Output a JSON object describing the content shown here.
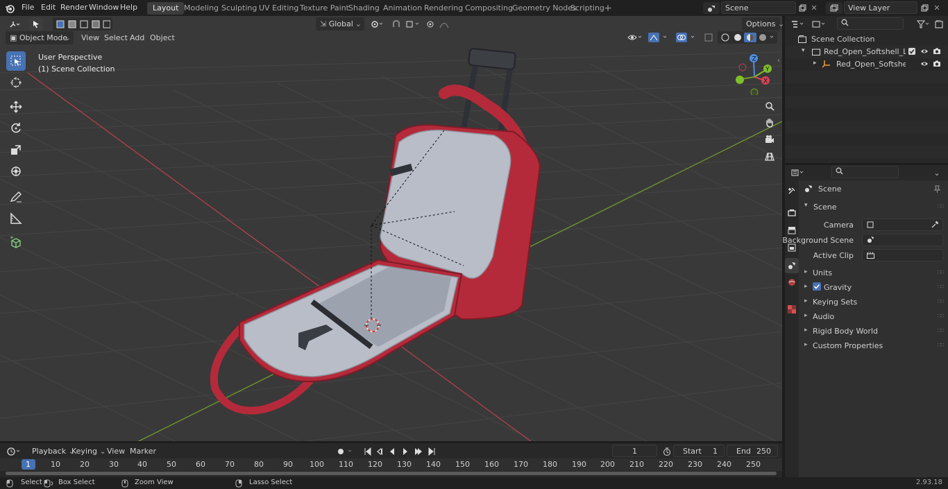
{
  "topbar": {
    "menus": [
      "File",
      "Edit",
      "Render",
      "Window",
      "Help"
    ],
    "workspaces": [
      "Layout",
      "Modeling",
      "Sculpting",
      "UV Editing",
      "Texture Paint",
      "Shading",
      "Animation",
      "Rendering",
      "Compositing",
      "Geometry Nodes",
      "Scripting"
    ],
    "active_workspace": "Layout",
    "scene_name": "Scene",
    "view_layer": "View Layer"
  },
  "viewport": {
    "mode": "Object Mode",
    "menus": [
      "View",
      "Select",
      "Add",
      "Object"
    ],
    "orientation": "Global",
    "options_label": "Options",
    "overlay_line1": "User Perspective",
    "overlay_line2": "(1) Scene Collection",
    "gizmo_axes": [
      "X",
      "Y",
      "Z"
    ]
  },
  "outliner": {
    "root": "Scene Collection",
    "items": [
      {
        "label": "Red_Open_Softshell_Luggage"
      },
      {
        "label": "Red_Open_Softshell_Lug"
      }
    ]
  },
  "properties": {
    "context": "Scene",
    "panel": "Scene",
    "fields": [
      {
        "label": "Camera",
        "value": ""
      },
      {
        "label": "Background Scene",
        "value": ""
      },
      {
        "label": "Active Clip",
        "value": ""
      }
    ],
    "subpanels": [
      "Units",
      "Gravity",
      "Keying Sets",
      "Audio",
      "Rigid Body World",
      "Custom Properties"
    ]
  },
  "timeline": {
    "menus": [
      "Playback",
      "Keying",
      "View",
      "Marker"
    ],
    "current_frame": "1",
    "start_label": "Start",
    "start": "1",
    "end_label": "End",
    "end": "250",
    "ruler": [
      "1",
      "10",
      "20",
      "30",
      "40",
      "50",
      "60",
      "70",
      "80",
      "90",
      "100",
      "110",
      "120",
      "130",
      "140",
      "150",
      "160",
      "170",
      "180",
      "190",
      "200",
      "210",
      "220",
      "230",
      "240",
      "250"
    ]
  },
  "statusbar": {
    "hints": [
      "Select",
      "Box Select",
      "Zoom View",
      "Lasso Select"
    ],
    "version": "2.93.18"
  },
  "colors": {
    "accent": "#4772b3",
    "luggage_red": "#b52a3a",
    "lining": "#b8bdc8",
    "x_axis": "#d74356",
    "y_axis": "#7fbf2a",
    "z_axis": "#4f8de3"
  }
}
